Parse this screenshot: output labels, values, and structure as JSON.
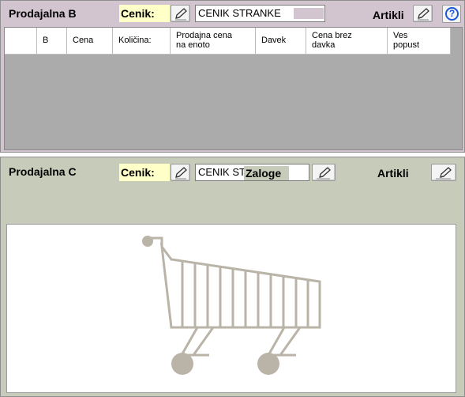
{
  "panel_b": {
    "title": "Prodajalna B",
    "cenik_label": "Cenik:",
    "cenik_value": "CENIK STRANKE",
    "artikli_label": "Artikli",
    "help_icon_text": "?",
    "columns": [
      {
        "label": ""
      },
      {
        "label": "B"
      },
      {
        "label": "Cena"
      },
      {
        "label": "Količina:"
      },
      {
        "label": "Prodajna cena\nna enoto"
      },
      {
        "label": "Davek"
      },
      {
        "label": "Cena brez\ndavka"
      },
      {
        "label": "Ves\npopust"
      }
    ]
  },
  "panel_c": {
    "title": "Prodajalna C",
    "cenik_label": "Cenik:",
    "cenik_value": "CENIK ST",
    "zaloge_label": "Zaloge",
    "artikli_label": "Artikli"
  },
  "colors": {
    "panel_b_bg": "#d3c5d0",
    "panel_c_bg": "#c6cbba",
    "cenik_label_bg": "#ffffc8",
    "grid_empty_bg": "#ababab",
    "help_icon": "#1a56d6",
    "cart_color": "#b9b4a7"
  },
  "icons": {
    "edit": "pencil-icon",
    "help": "question-circle-icon",
    "placeholder": "shopping-cart-icon"
  }
}
